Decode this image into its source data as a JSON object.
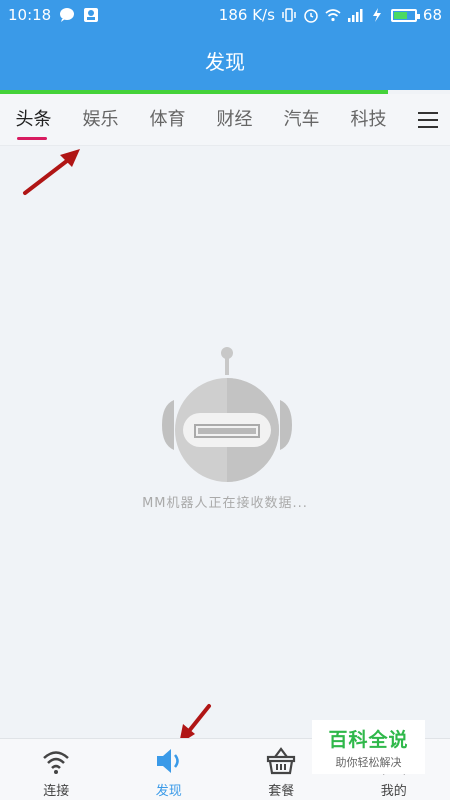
{
  "status": {
    "time": "10:18",
    "speed": "186 K/s",
    "battery": "68"
  },
  "header": {
    "title": "发现"
  },
  "tabs": [
    {
      "label": "头条"
    },
    {
      "label": "娱乐"
    },
    {
      "label": "体育"
    },
    {
      "label": "财经"
    },
    {
      "label": "汽车"
    },
    {
      "label": "科技"
    }
  ],
  "main": {
    "loading_text": "MM机器人正在接收数据..."
  },
  "bottom_nav": [
    {
      "label": "连接"
    },
    {
      "label": "发现"
    },
    {
      "label": "套餐"
    },
    {
      "label": "我的"
    }
  ],
  "watermark": {
    "title": "百科全说",
    "subtitle": "助你轻松解决"
  },
  "colors": {
    "primary": "#3a9ae8",
    "progress": "#44d23a",
    "tab_indicator": "#d81b60",
    "arrow": "#b01515"
  }
}
